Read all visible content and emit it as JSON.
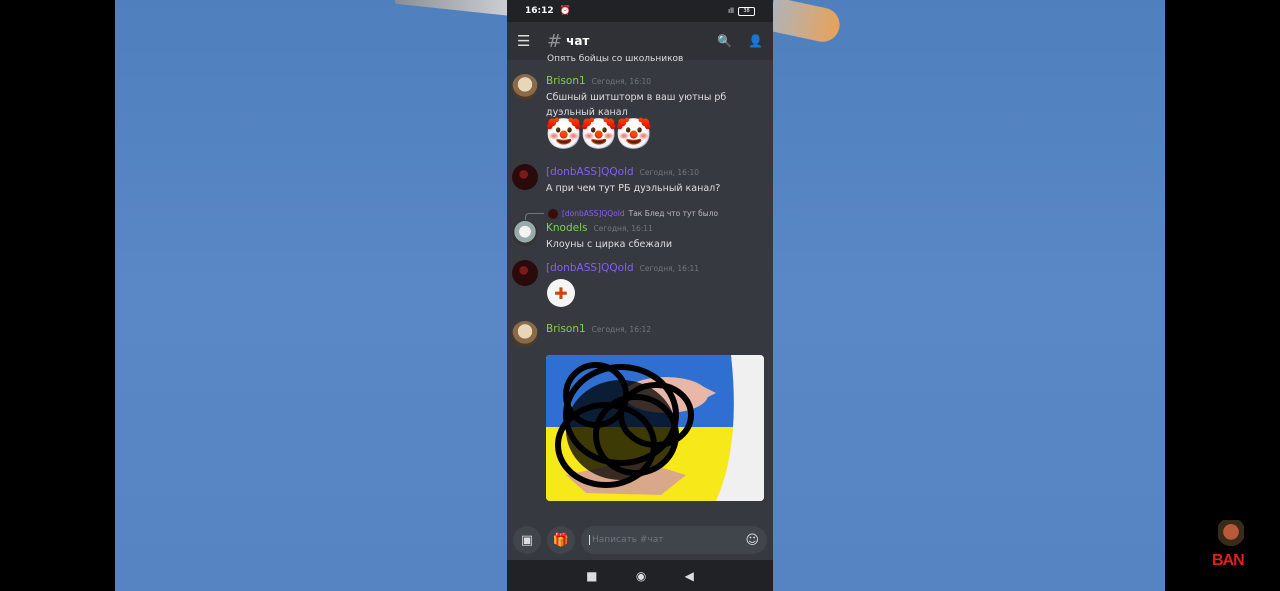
{
  "status_bar": {
    "time": "16:12",
    "alarm_icon": "alarm-icon",
    "signal_text": "ıll",
    "battery": "38"
  },
  "header": {
    "channel_hash": "#",
    "channel_name": "чат"
  },
  "chat": {
    "cut_text": "Опять бойцы со школьников",
    "messages": [
      {
        "author": "Brison1",
        "time": "Сегодня, 16:10",
        "text": "Сбшный шитшторм в ваш уютны рб дуэльный канал",
        "emoji": [
          "🤡",
          "🤡",
          "🤡"
        ]
      },
      {
        "author": "[donbASS]QQold",
        "time": "Сегодня, 16:10",
        "text": "А при чем тут РБ дуэльный канал?"
      },
      {
        "reply_to_author": "[donbASS]QQold",
        "reply_to_text": "Так Блед что тут было",
        "author": "Knodels",
        "time": "Сегодня, 16:11",
        "text": "Клоуны с цирка сбежали"
      },
      {
        "author": "[donbASS]QQold",
        "time": "Сегодня, 16:11",
        "sticker": "troll-face-sticker"
      },
      {
        "author": "Brison1",
        "time": "Сегодня, 16:12",
        "attachment": "pig-image"
      }
    ]
  },
  "composer": {
    "placeholder": "Написать #чат"
  },
  "watermark": {
    "text": "BAN"
  },
  "colors": {
    "brison_name": "#7bd54a",
    "donbass_name": "#8a5cf5",
    "knodels_name": "#7bd54a",
    "bg": "#36393f"
  }
}
